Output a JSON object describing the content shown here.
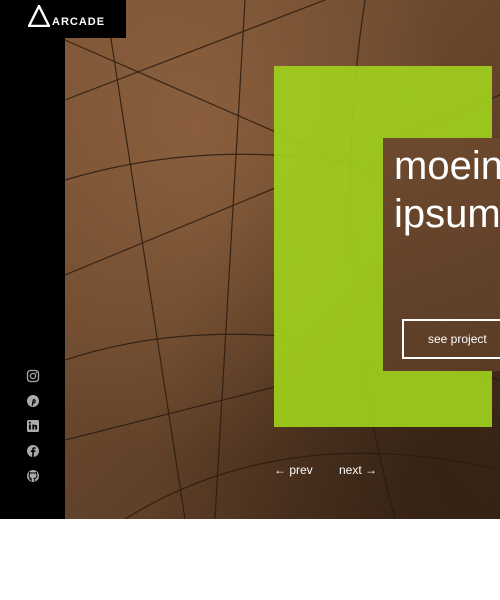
{
  "brand": {
    "name": "ARCADE"
  },
  "hero": {
    "title_line1": "moein",
    "title_line2": "ipsum",
    "cta_label": "see project",
    "prev_label": "← prev",
    "next_label": "next →"
  },
  "social": [
    "instagram-icon",
    "pinterest-icon",
    "linkedin-icon",
    "facebook-icon",
    "github-icon"
  ],
  "colors": {
    "accent": "#9fd01c",
    "sidebar": "#000000",
    "text": "#ffffff"
  }
}
